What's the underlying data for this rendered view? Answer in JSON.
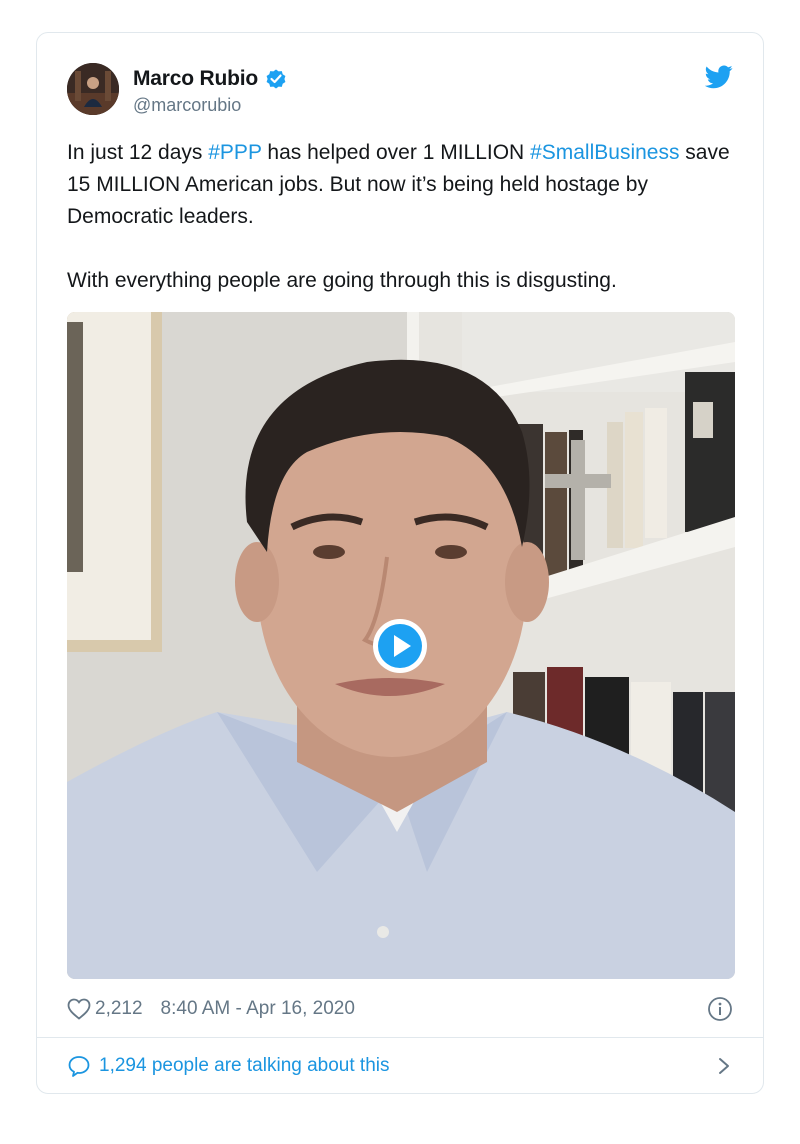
{
  "user": {
    "display_name": "Marco Rubio",
    "handle": "@marcorubio",
    "verified": true
  },
  "tweet": {
    "paragraphs": [
      [
        {
          "text": "In just 12 days ",
          "hashtag": false
        },
        {
          "text": "#PPP",
          "hashtag": true
        },
        {
          "text": " has helped over 1 MILLION ",
          "hashtag": false
        },
        {
          "text": "#SmallBusiness",
          "hashtag": true
        },
        {
          "text": " save 15 MILLION American jobs. But now it’s being held hostage by Democratic leaders.",
          "hashtag": false
        }
      ],
      [
        {
          "text": "With everything people are going through this is disgusting.",
          "hashtag": false
        }
      ]
    ]
  },
  "stats": {
    "likes": "2,212",
    "timestamp": "8:40 AM - Apr 16, 2020"
  },
  "footer": {
    "talking_text": "1,294 people are talking about this"
  },
  "icons": {
    "verified": "verified-badge-icon",
    "bird": "twitter-bird-icon",
    "heart": "heart-icon",
    "info": "info-icon",
    "bubble": "comment-bubble-icon",
    "chevron": "chevron-right-icon",
    "play": "play-icon"
  },
  "colors": {
    "accent": "#1b95e0",
    "secondary_text": "#657786",
    "primary_text": "#14171a",
    "border": "#e1e8ed"
  }
}
